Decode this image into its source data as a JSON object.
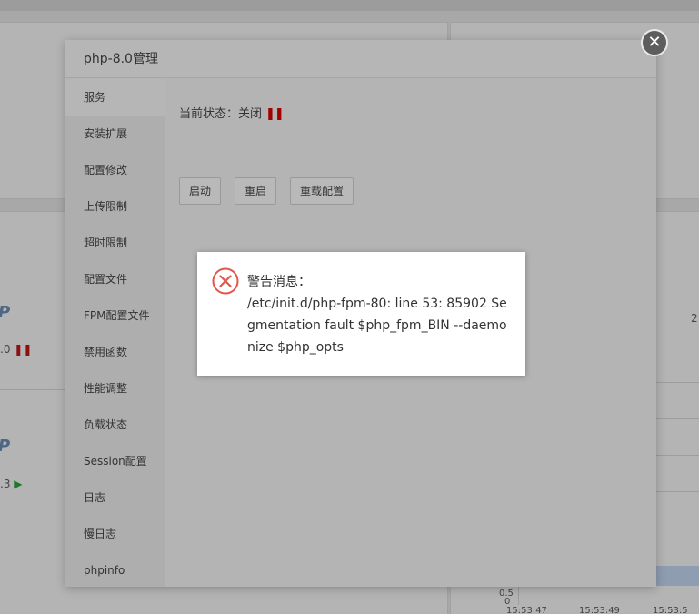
{
  "background": {
    "php_logo_1": "P",
    "php_version_1": ".0",
    "php_logo_2": "P",
    "php_version_2": ".3",
    "right_text": "2",
    "axis_label_y": "0",
    "axis_label_y2": "0.5",
    "axis_ticks": [
      "15:53:47",
      "15:53:49",
      "15:53:5"
    ]
  },
  "modal": {
    "title": "php-8.0管理",
    "close_glyph": "✕",
    "sidebar": {
      "items": [
        {
          "label": "服务",
          "active": true
        },
        {
          "label": "安装扩展"
        },
        {
          "label": "配置修改"
        },
        {
          "label": "上传限制"
        },
        {
          "label": "超时限制"
        },
        {
          "label": "配置文件"
        },
        {
          "label": "FPM配置文件"
        },
        {
          "label": "禁用函数"
        },
        {
          "label": "性能调整"
        },
        {
          "label": "负载状态"
        },
        {
          "label": "Session配置"
        },
        {
          "label": "日志"
        },
        {
          "label": "慢日志"
        },
        {
          "label": "phpinfo"
        }
      ]
    },
    "service": {
      "status_label": "当前状态：",
      "status_value": "关闭",
      "buttons": {
        "start": "启动",
        "restart": "重启",
        "reload": "重载配置"
      }
    }
  },
  "alert": {
    "title": "警告消息：",
    "message": "/etc/init.d/php-fpm-80: line 53: 85902 Segmentation fault $php_fpm_BIN --daemonize $php_opts",
    "icon": "error-circle-x-icon",
    "icon_color": "#e2574c"
  }
}
